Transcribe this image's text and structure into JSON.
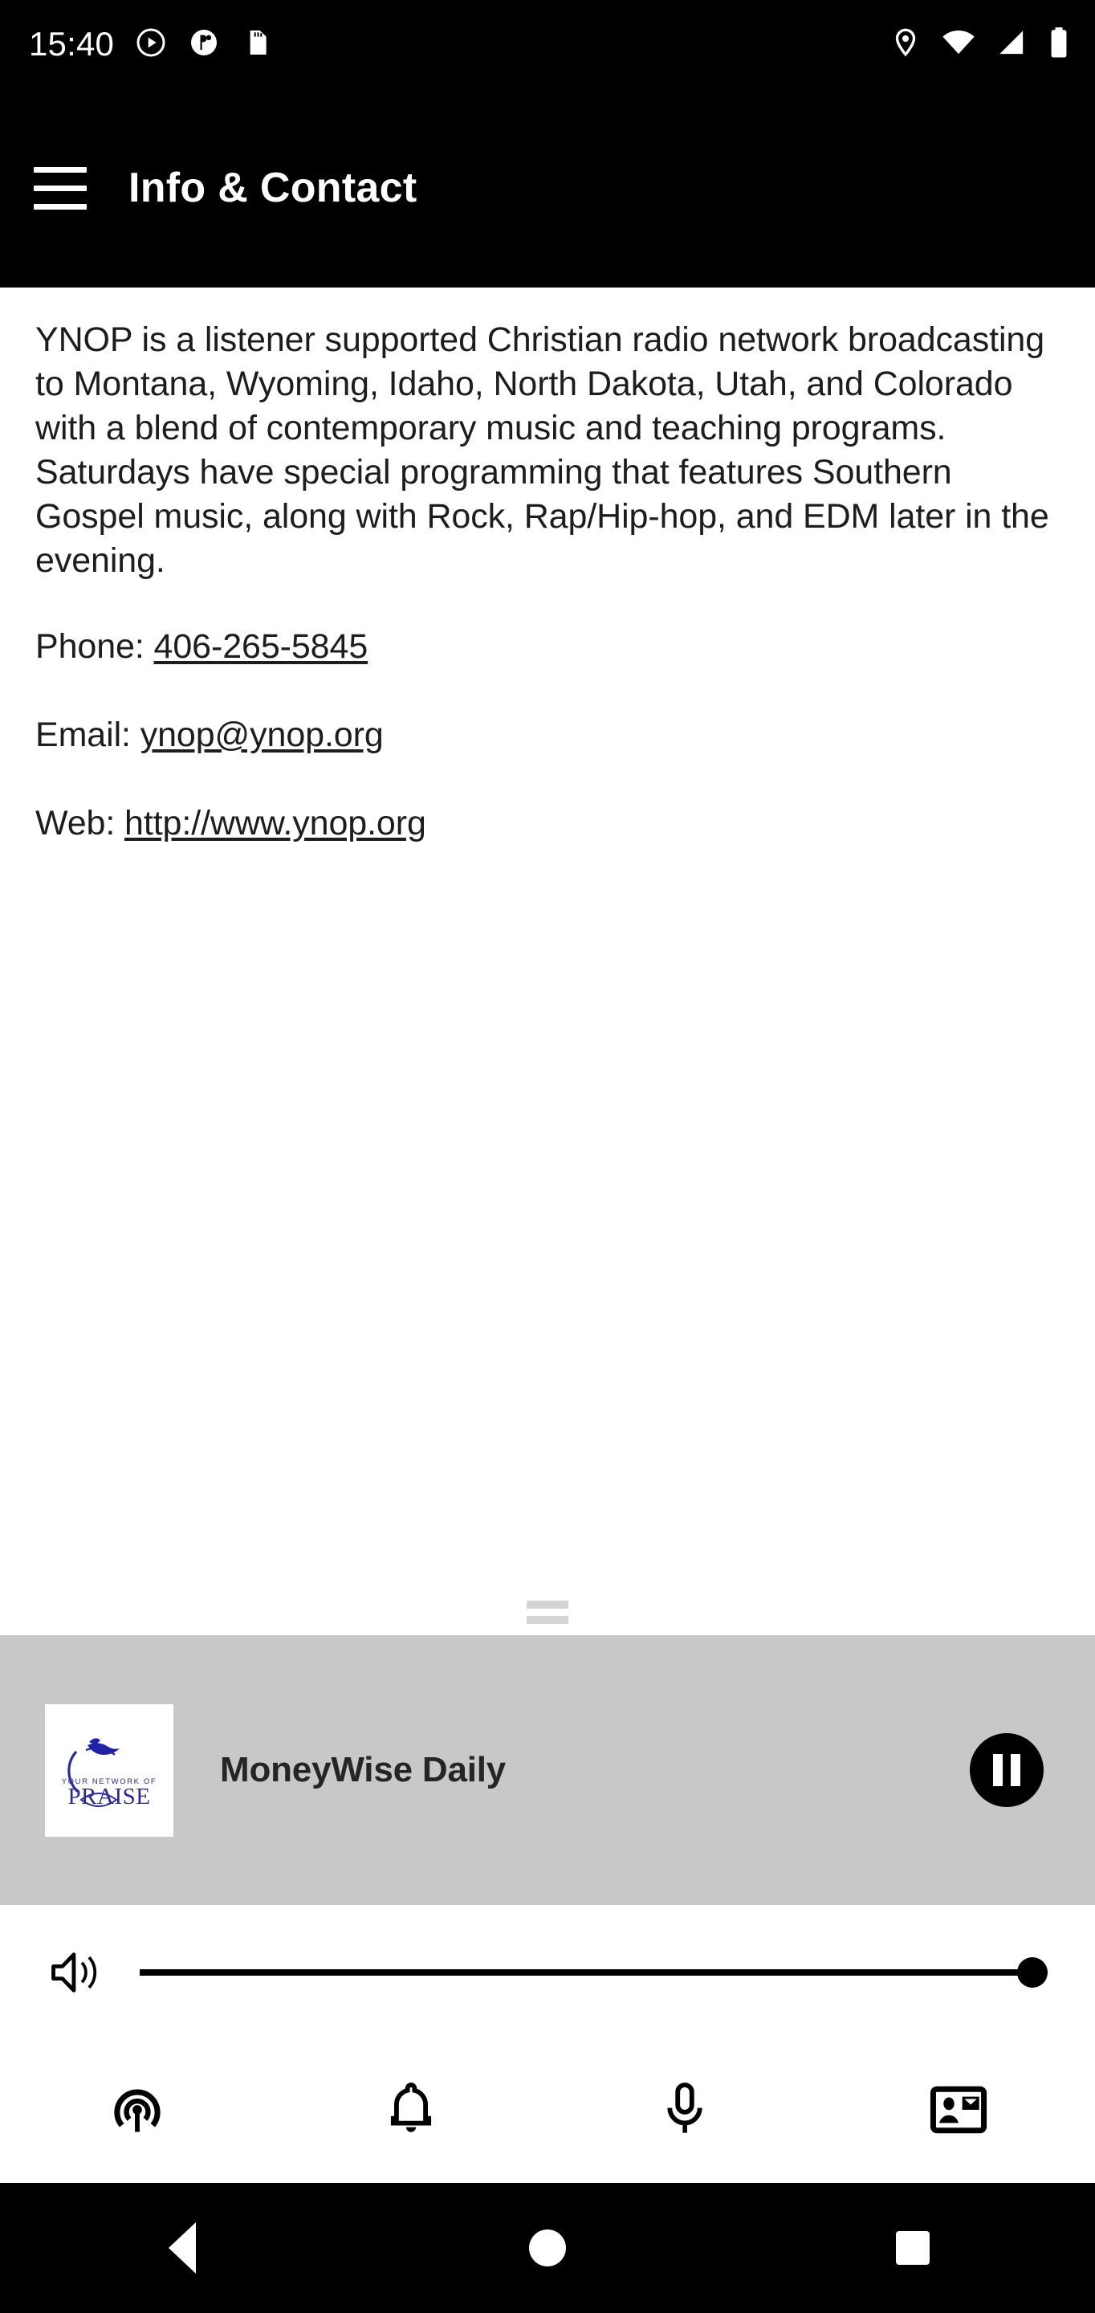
{
  "status_bar": {
    "time": "15:40",
    "left_icons": [
      "play-circle-icon",
      "do-not-disturb-icon",
      "sd-card-icon"
    ],
    "right_icons": [
      "location-pin-icon",
      "wifi-icon",
      "cellular-signal-icon",
      "battery-icon"
    ]
  },
  "app_bar": {
    "menu_icon": "hamburger-menu-icon",
    "title": "Info & Contact"
  },
  "content": {
    "description": "YNOP is a listener supported Christian radio network broadcasting to Montana, Wyoming, Idaho, North Dakota, Utah, and Colorado with a blend of contemporary music and teaching programs. Saturdays have special programming that features Southern Gospel music, along with Rock, Rap/Hip-hop, and EDM later in the evening.",
    "phone_label": "Phone: ",
    "phone_value": "406-265-5845",
    "email_label": "Email: ",
    "email_value": "ynop@ynop.org",
    "web_label": "Web: ",
    "web_value": "http://www.ynop.org"
  },
  "player": {
    "drag_handle_icon": "drag-handle-icon",
    "album_art_icon": "station-logo-your-network-of-praise",
    "album_art_text_top": "YOUR NETWORK OF",
    "album_art_text_main": "PRAISE",
    "track_title": "MoneyWise Daily",
    "transport_icon": "pause-icon",
    "background_color": "#c8c8c8"
  },
  "volume": {
    "icon": "volume-up-icon",
    "value": 100,
    "min": 0,
    "max": 100
  },
  "bottom_nav": {
    "items": [
      {
        "icon": "broadcast-tower-icon",
        "name": "live-radio"
      },
      {
        "icon": "bell-icon",
        "name": "alerts"
      },
      {
        "icon": "microphone-icon",
        "name": "podcasts"
      },
      {
        "icon": "contact-card-icon",
        "name": "info-contact"
      }
    ]
  },
  "android_nav": {
    "back": "back-triangle-icon",
    "home": "home-circle-icon",
    "recents": "recents-square-icon"
  }
}
